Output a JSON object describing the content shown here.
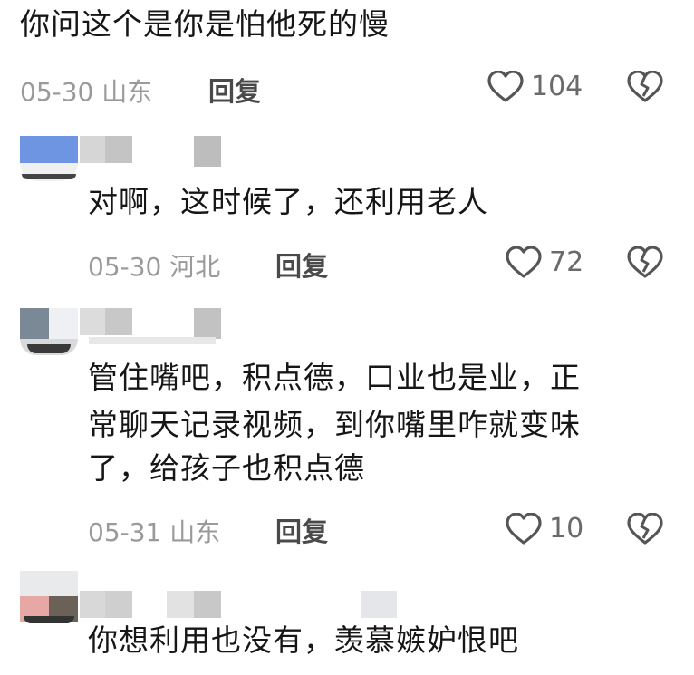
{
  "comments": [
    {
      "text": "你问这个是你是怕他死的慢",
      "date": "05-30",
      "location": "山东",
      "reply": "回复",
      "likes": "104"
    },
    {
      "text": "对啊，这时候了，还利用老人",
      "date": "05-30",
      "location": "河北",
      "reply": "回复",
      "likes": "72"
    },
    {
      "lines": [
        "管住嘴吧，积点德，口业也是业，正",
        "常聊天记录视频，到你嘴里咋就变味",
        "了，给孩子也积点德"
      ],
      "date": "05-31",
      "location": "山东",
      "reply": "回复",
      "likes": "10"
    },
    {
      "text": "你想利用也没有，羡慕嫉妒恨吧"
    }
  ],
  "icons": {
    "like": "heart-outline-icon",
    "dislike": "broken-heart-icon"
  },
  "colors": {
    "text": "#161616",
    "meta": "#9a9a9a",
    "reply": "#4a4a4a",
    "icon": "#555555"
  }
}
